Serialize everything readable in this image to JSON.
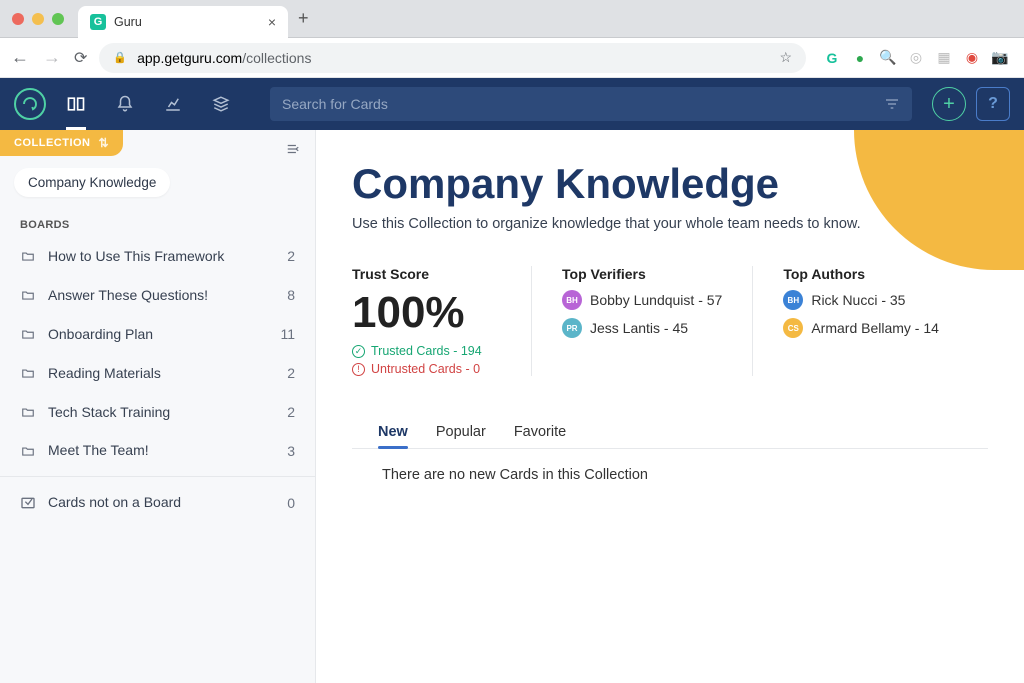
{
  "browser": {
    "tab_title": "Guru",
    "url_host": "app.getguru.com",
    "url_path": "/collections"
  },
  "header": {
    "search_placeholder": "Search for Cards"
  },
  "sidebar": {
    "collection_label": "COLLECTION",
    "collection_name": "Company Knowledge",
    "boards_label": "BOARDS",
    "boards": [
      {
        "name": "How to Use This Framework",
        "count": "2"
      },
      {
        "name": "Answer These Questions!",
        "count": "8"
      },
      {
        "name": "Onboarding Plan",
        "count": "11"
      },
      {
        "name": "Reading Materials",
        "count": "2"
      },
      {
        "name": "Tech Stack Training",
        "count": "2"
      },
      {
        "name": "Meet The Team!",
        "count": "3"
      }
    ],
    "unassigned": {
      "name": "Cards not on a Board",
      "count": "0"
    }
  },
  "content": {
    "title": "Company Knowledge",
    "subtitle": "Use this Collection to organize knowledge that your whole team needs to know.",
    "trust": {
      "label": "Trust Score",
      "score": "100%",
      "trusted": "Trusted Cards - 194",
      "untrusted": "Untrusted Cards - 0"
    },
    "verifiers": {
      "label": "Top Verifiers",
      "people": [
        {
          "initials": "BH",
          "text": "Bobby Lundquist - 57",
          "color": "#b865d6"
        },
        {
          "initials": "PR",
          "text": "Jess Lantis  - 45",
          "color": "#5bb5c9"
        }
      ]
    },
    "authors": {
      "label": "Top Authors",
      "people": [
        {
          "initials": "BH",
          "text": "Rick Nucci - 35",
          "color": "#3b82d6"
        },
        {
          "initials": "CS",
          "text": "Armard Bellamy - 14",
          "color": "#f4b942"
        }
      ]
    },
    "tabs": [
      {
        "label": "New",
        "active": true
      },
      {
        "label": "Popular",
        "active": false
      },
      {
        "label": "Favorite",
        "active": false
      }
    ],
    "empty_message": "There are no new Cards in this Collection"
  }
}
